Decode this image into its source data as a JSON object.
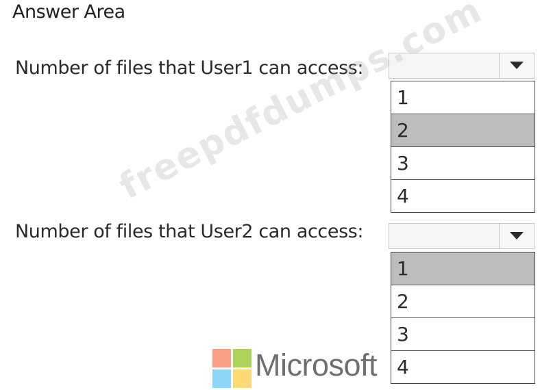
{
  "title": "Answer Area",
  "questions": [
    {
      "label": "Number of files that User1 can access:",
      "selected_value": "",
      "options": [
        "1",
        "2",
        "3",
        "4"
      ],
      "highlighted_option": "2"
    },
    {
      "label": "Number of files that User2 can access:",
      "selected_value": "",
      "options": [
        "1",
        "2",
        "3",
        "4"
      ],
      "highlighted_option": "1"
    }
  ],
  "watermark": "freepdfdumps.com",
  "brand": {
    "text": "Microsoft",
    "colors": [
      "#f25022",
      "#7fba00",
      "#00a4ef",
      "#ffb900"
    ]
  },
  "icons": {
    "dropdown_arrow": "chevron-down-icon",
    "logo": "microsoft-logo-icon"
  }
}
